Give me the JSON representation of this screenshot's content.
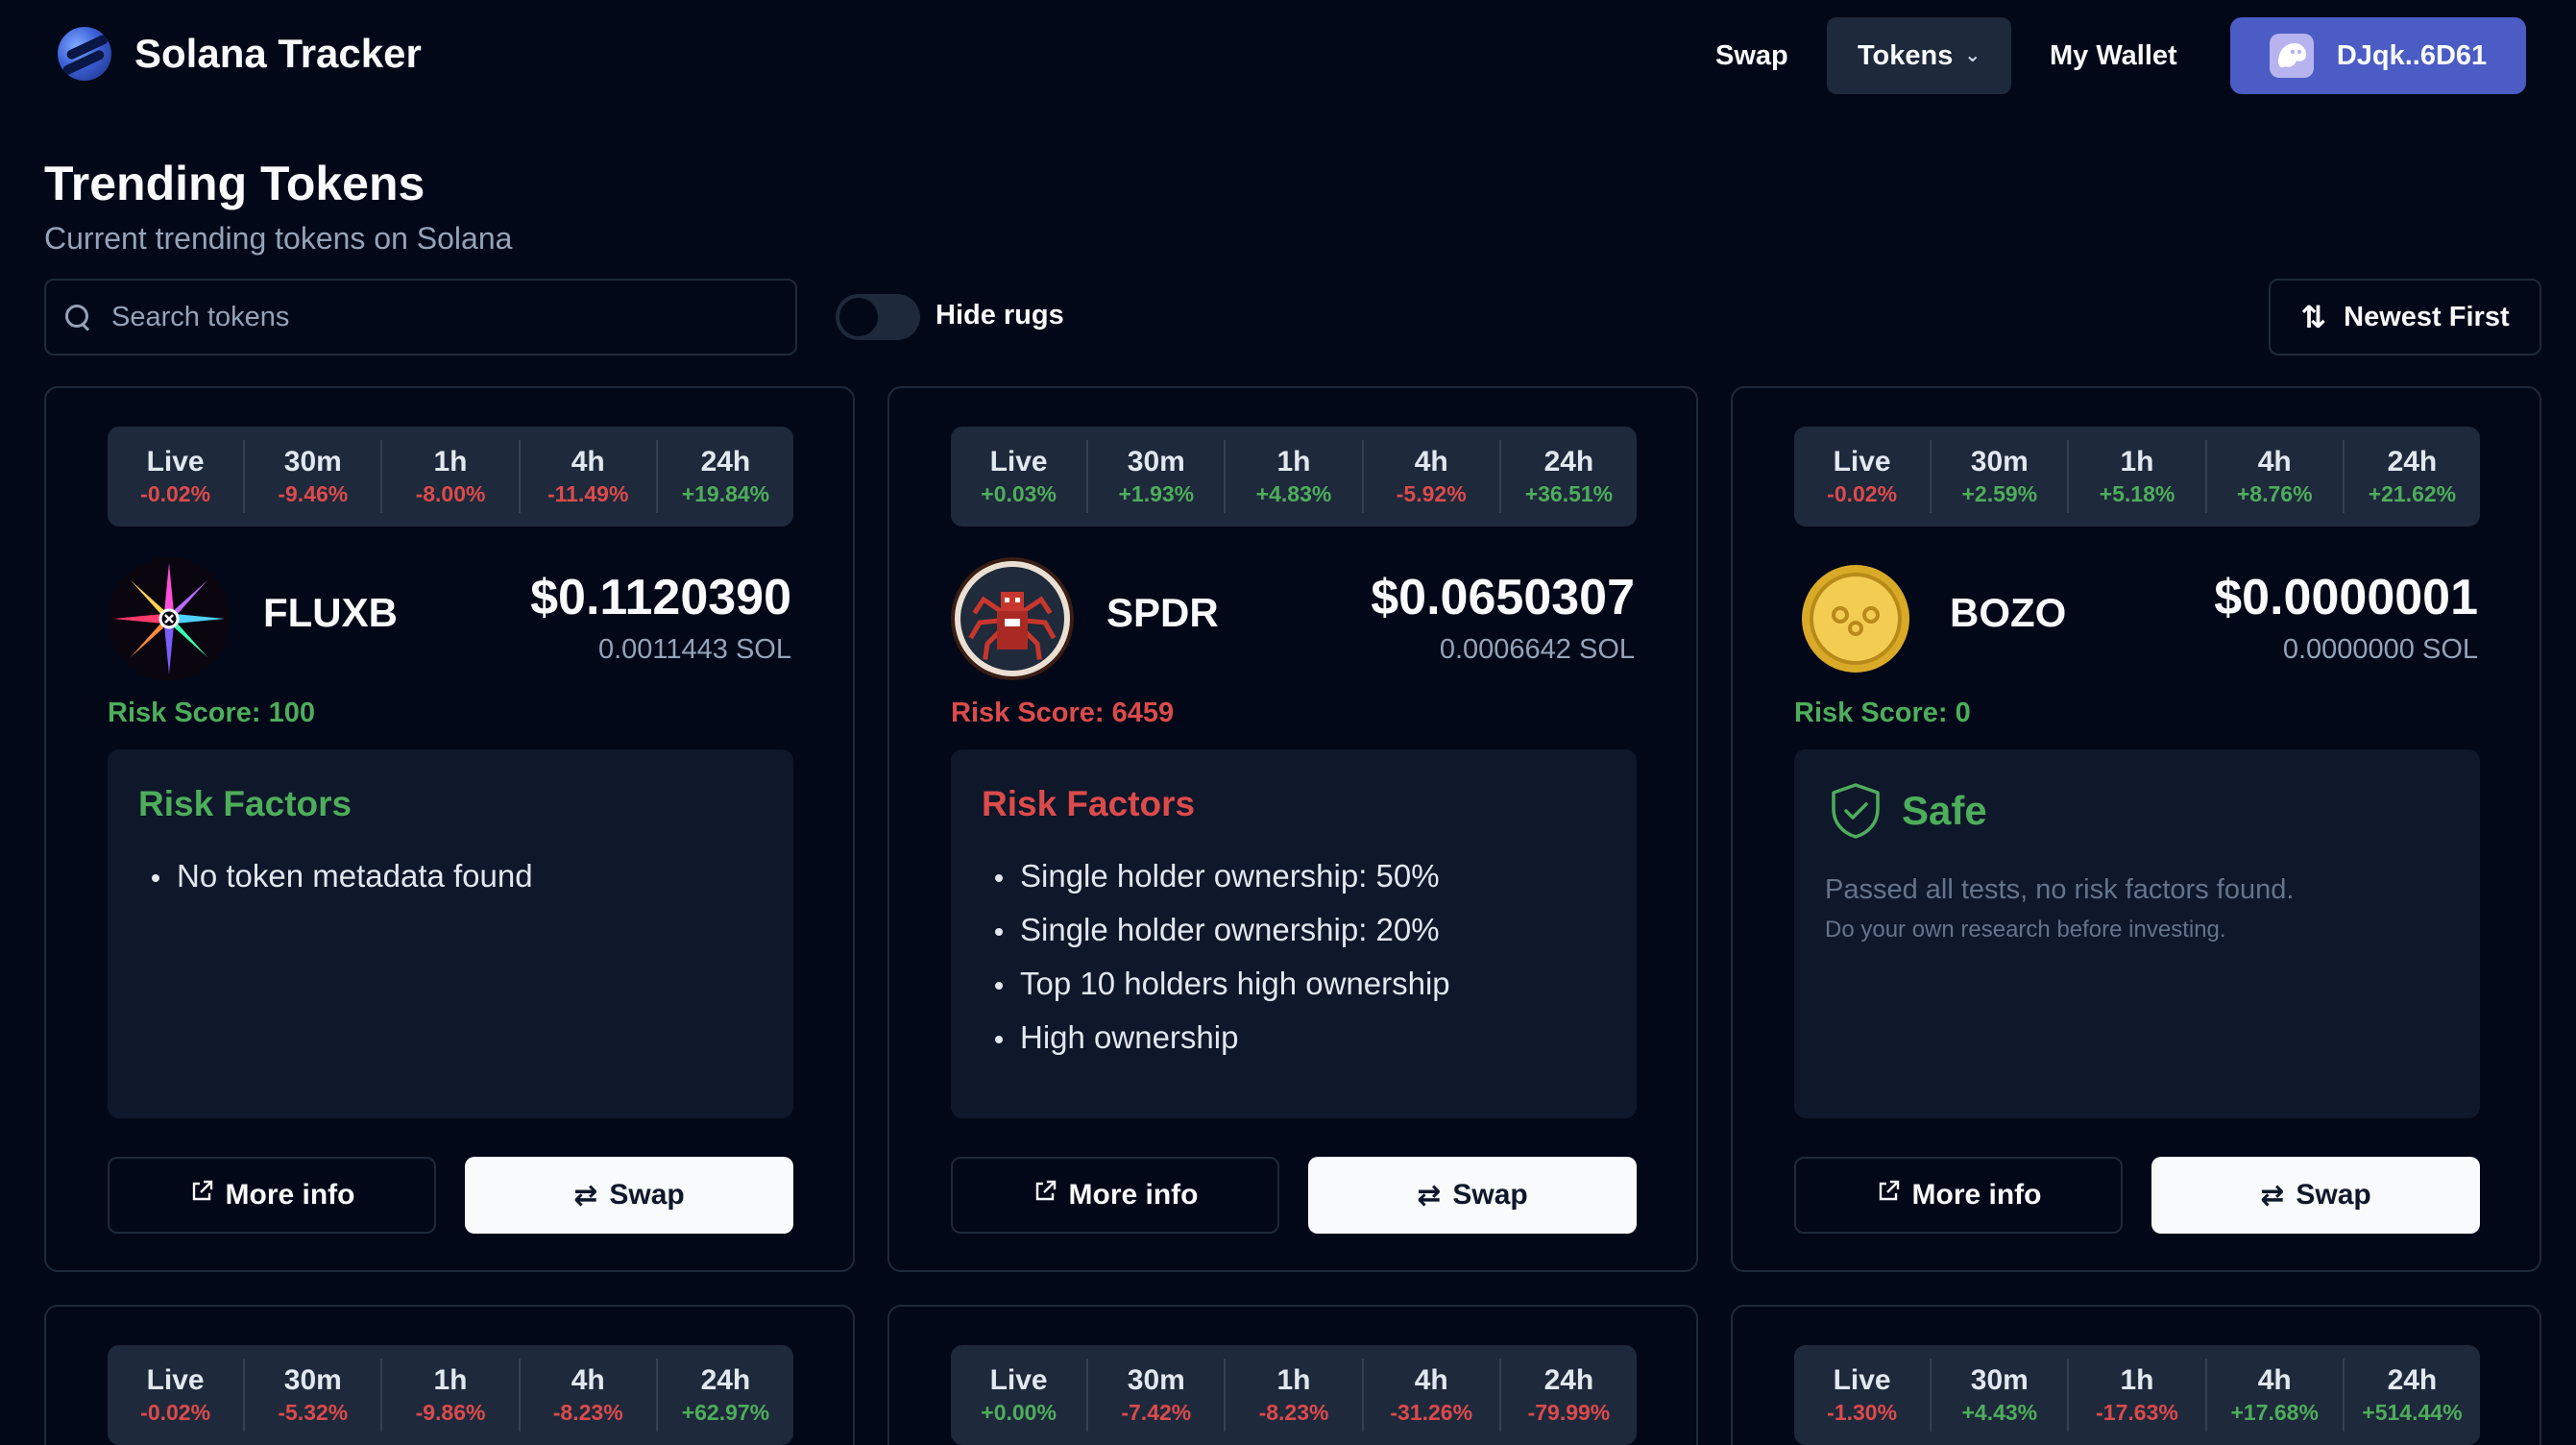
{
  "header": {
    "brand": "Solana Tracker",
    "nav": {
      "swap": "Swap",
      "tokens": "Tokens",
      "wallet": "My Wallet"
    },
    "wallet_address": "DJqk..6D61"
  },
  "page": {
    "title": "Trending Tokens",
    "subtitle": "Current trending tokens on Solana"
  },
  "controls": {
    "search_placeholder": "Search tokens",
    "hide_rugs_label": "Hide rugs",
    "hide_rugs_enabled": false,
    "sort_label": "Newest First"
  },
  "period_labels": [
    "Live",
    "30m",
    "1h",
    "4h",
    "24h"
  ],
  "buttons": {
    "more_info": "More info",
    "swap": "Swap"
  },
  "cards": [
    {
      "symbol": "FLUXB",
      "changes": [
        "-0.02%",
        "-9.46%",
        "-8.00%",
        "-11.49%",
        "+19.84%"
      ],
      "price": "$0.1120390",
      "price_sol": "0.0011443 SOL",
      "risk_score_label": "Risk Score: 100",
      "risk_level": "low",
      "risk_title": "Risk Factors",
      "risk_factors": [
        "No token metadata found"
      ]
    },
    {
      "symbol": "SPDR",
      "changes": [
        "+0.03%",
        "+1.93%",
        "+4.83%",
        "-5.92%",
        "+36.51%"
      ],
      "price": "$0.0650307",
      "price_sol": "0.0006642 SOL",
      "risk_score_label": "Risk Score: 6459",
      "risk_level": "high",
      "risk_title": "Risk Factors",
      "risk_factors": [
        "Single holder ownership: 50%",
        "Single holder ownership: 20%",
        "Top 10 holders high ownership",
        "High ownership"
      ]
    },
    {
      "symbol": "BOZO",
      "changes": [
        "-0.02%",
        "+2.59%",
        "+5.18%",
        "+8.76%",
        "+21.62%"
      ],
      "price": "$0.0000001",
      "price_sol": "0.0000000 SOL",
      "risk_score_label": "Risk Score: 0",
      "risk_level": "safe",
      "safe_title": "Safe",
      "safe_text": "Passed all tests, no risk factors found.",
      "safe_note": "Do your own research before investing."
    },
    {
      "changes": [
        "-0.02%",
        "-5.32%",
        "-9.86%",
        "-8.23%",
        "+62.97%"
      ]
    },
    {
      "changes": [
        "+0.00%",
        "-7.42%",
        "-8.23%",
        "-31.26%",
        "-79.99%"
      ]
    },
    {
      "changes": [
        "-1.30%",
        "+4.43%",
        "-17.63%",
        "+17.68%",
        "+514.44%"
      ]
    }
  ],
  "colors": {
    "positive": "#4ead5b",
    "negative": "#dc4b4b",
    "wallet": "#4b5cc4"
  }
}
